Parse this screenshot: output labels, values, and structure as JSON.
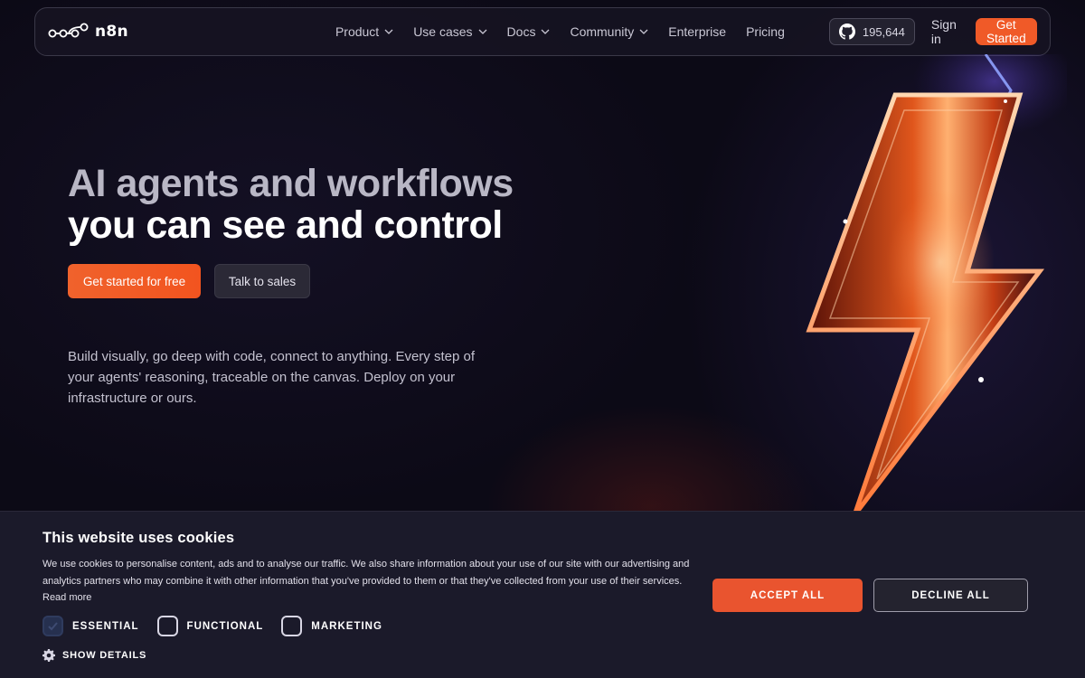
{
  "nav": {
    "logo_text": "n8n",
    "items": [
      {
        "label": "Product",
        "dropdown": true
      },
      {
        "label": "Use cases",
        "dropdown": true
      },
      {
        "label": "Docs",
        "dropdown": true
      },
      {
        "label": "Community",
        "dropdown": true
      },
      {
        "label": "Enterprise",
        "dropdown": false
      },
      {
        "label": "Pricing",
        "dropdown": false
      }
    ],
    "github_stars": "195,644",
    "sign_in": "Sign in",
    "get_started": "Get Started"
  },
  "hero": {
    "title_line1": "AI agents and workflows",
    "title_line2": "you can see and control",
    "primary_cta": "Get started for free",
    "secondary_cta": "Talk to sales",
    "description": "Build visually, go deep with code, connect to anything. Every step of your agents' reasoning, traceable on the canvas. Deploy on your infrastructure or ours."
  },
  "cookie": {
    "title": "This website uses cookies",
    "text": "We use cookies to personalise content, ads and to analyse our traffic. We also share information about your use of our site with our advertising and analytics partners who may combine it with other information that you've provided to them or that they've collected from your use of their services.",
    "read_more": "Read more",
    "options": [
      {
        "label": "ESSENTIAL",
        "checked": true
      },
      {
        "label": "FUNCTIONAL",
        "checked": false
      },
      {
        "label": "MARKETING",
        "checked": false
      }
    ],
    "show_details": "SHOW DETAILS",
    "accept": "ACCEPT ALL",
    "decline": "DECLINE ALL"
  },
  "colors": {
    "accent": "#f05a28",
    "background": "#0e0c18",
    "banner": "#1b1a2a"
  }
}
